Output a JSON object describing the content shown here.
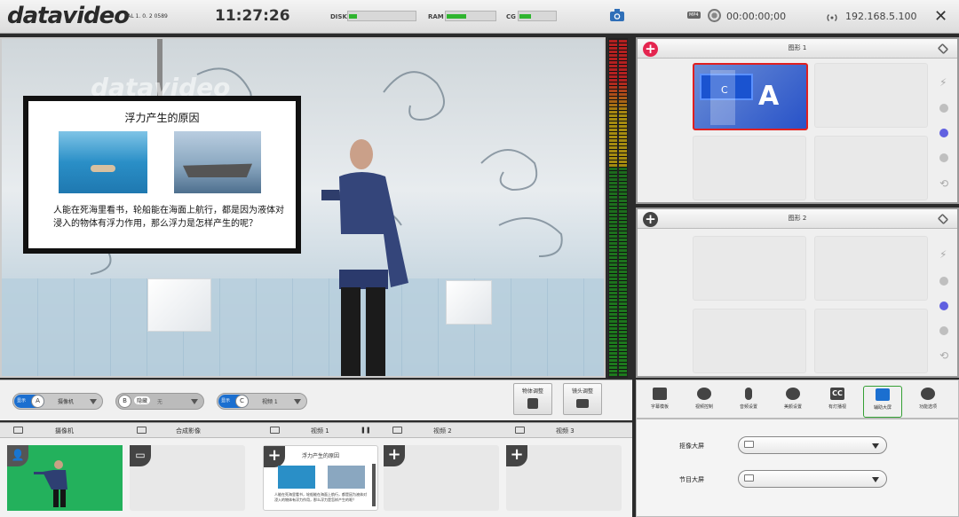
{
  "topbar": {
    "logo": "datavideo",
    "version": "PAL 1. 0. 2 0589",
    "clock": "11:27:26",
    "disk_label": "DISK",
    "ram_label": "RAM",
    "cg_label": "CG",
    "disk_usage": 0.12,
    "ram_usage": 0.4,
    "cg_usage": 0.3,
    "mp4_badge": "MP4",
    "record_time": "00:00:00;00",
    "ip": "192.168.5.100",
    "close_glyph": "✕"
  },
  "program": {
    "watermark": "datavideo",
    "board": {
      "title": "浮力产生的原因",
      "text": "人能在死海里看书，轮船能在海面上航行，都是因为液体对浸入的物体有浮力作用，那么浮力是怎样产生的呢？"
    }
  },
  "graphics": [
    {
      "title": "图形 1",
      "add_color": "#e4254f",
      "selected_thumb_letter": "A",
      "selected_thumb_tag": "C"
    },
    {
      "title": "图形 2",
      "add_color": "#444444"
    }
  ],
  "switches": [
    {
      "badge": "显示",
      "key": "A",
      "label": "摄像机"
    },
    {
      "badge": "",
      "key": "B",
      "label": "隐藏",
      "value": "无"
    },
    {
      "badge": "显示",
      "key": "C",
      "label": "视频 1"
    }
  ],
  "controls": {
    "object_adjust": "物体调整",
    "lens_adjust": "镜头调整"
  },
  "sources": {
    "headers": [
      "摄像机",
      "合成影像",
      "视频 1",
      "视频 2",
      "视频 3"
    ],
    "thumb_title": "浮力产生的原因",
    "thumb_text": "人能在死海里看书，轮船能在海面上航行，都是因为液体对浸入的物体有浮力作用，那么浮力是怎样产生的呢？"
  },
  "functions": {
    "buttons": [
      "字幕模板",
      "视频控制",
      "音频设置",
      "美颜设置",
      "有灯播视",
      "辅助大屏",
      "功能选项"
    ],
    "active_index": 5,
    "rows": [
      {
        "label": "抠像大屏"
      },
      {
        "label": "节目大屏"
      }
    ]
  },
  "colors": {
    "accent_blue": "#1b6fd0",
    "meter_green": "#2fb52f",
    "selected_red": "#e02020",
    "active_green": "#34a034"
  }
}
